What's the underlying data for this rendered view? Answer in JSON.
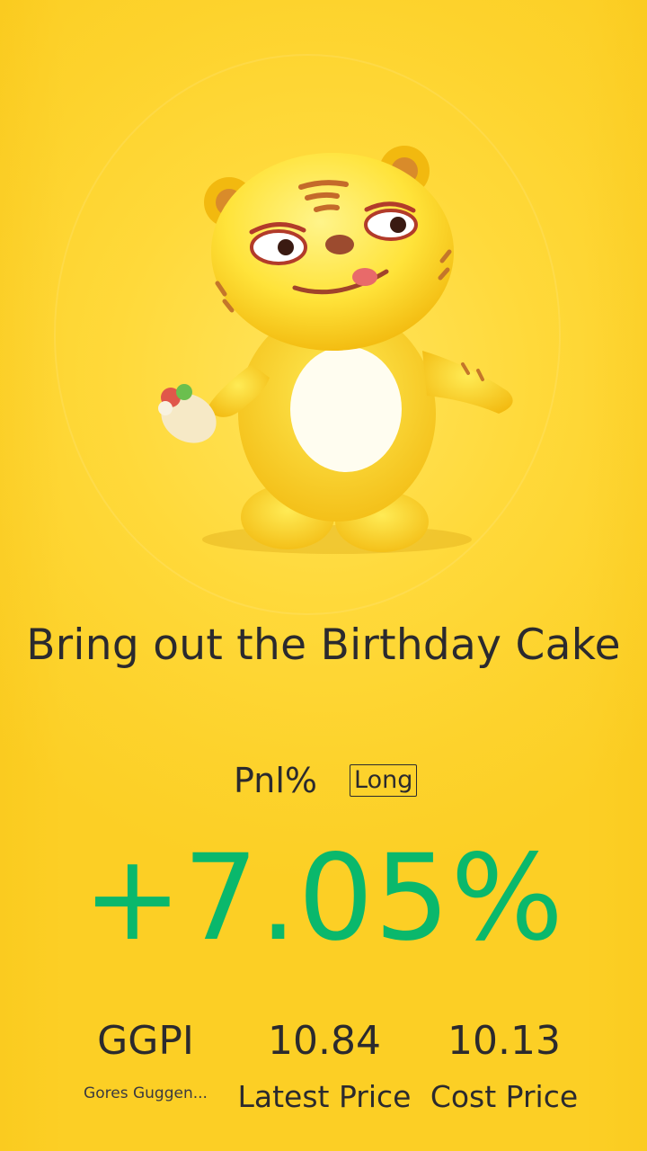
{
  "headline": "Bring out the Birthday Cake",
  "pnl": {
    "label": "Pnl%",
    "direction": "Long",
    "value": "+7.05%",
    "color": "#0ab86c"
  },
  "stats": [
    {
      "value": "GGPI",
      "caption": "Gores Guggen..."
    },
    {
      "value": "10.84",
      "caption": "Latest Price"
    },
    {
      "value": "10.13",
      "caption": "Cost Price"
    }
  ],
  "mascot": {
    "icon": "tiger-mascot-icon"
  }
}
